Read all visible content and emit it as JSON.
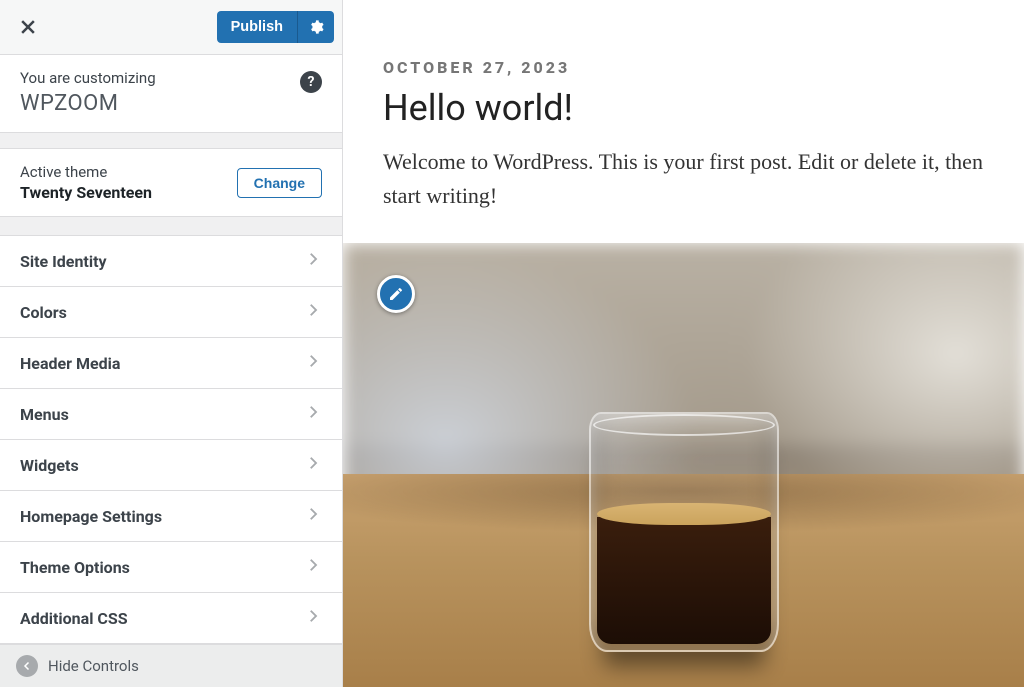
{
  "colors": {
    "accent": "#2271b1"
  },
  "topbar": {
    "publish_label": "Publish"
  },
  "context": {
    "eyebrow": "You are customizing",
    "site_title": "WPZOOM"
  },
  "theme": {
    "eyebrow": "Active theme",
    "name": "Twenty Seventeen",
    "change_label": "Change"
  },
  "sections": [
    {
      "label": "Site Identity"
    },
    {
      "label": "Colors"
    },
    {
      "label": "Header Media"
    },
    {
      "label": "Menus"
    },
    {
      "label": "Widgets"
    },
    {
      "label": "Homepage Settings"
    },
    {
      "label": "Theme Options"
    },
    {
      "label": "Additional CSS"
    }
  ],
  "footer": {
    "hide_controls_label": "Hide Controls"
  },
  "preview": {
    "post_date": "OCTOBER 27, 2023",
    "post_title": "Hello world!",
    "post_body": "Welcome to WordPress. This is your first post. Edit or delete it, then start writing!"
  }
}
